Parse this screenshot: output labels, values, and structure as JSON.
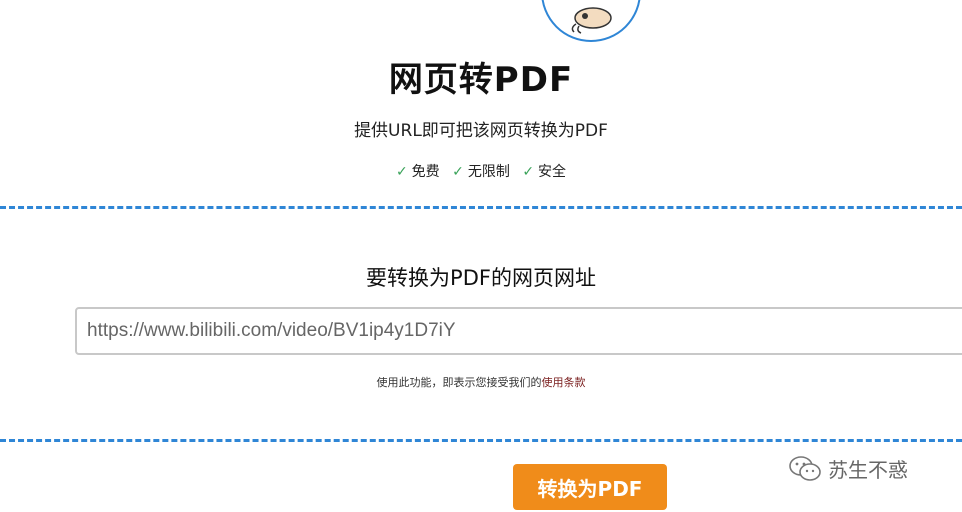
{
  "header": {
    "logo_icon": "mascot-logo-icon",
    "title": "网页转PDF",
    "subtitle": "提供URL即可把该网页转换为PDF",
    "features": [
      {
        "check": "✓",
        "label": "免费"
      },
      {
        "check": "✓",
        "label": "无限制"
      },
      {
        "check": "✓",
        "label": "安全"
      }
    ]
  },
  "form": {
    "label": "要转换为PDF的网页网址",
    "url_value": "https://www.bilibili.com/video/BV1ip4y1D7iY",
    "terms_prefix": "使用此功能，即表示您接受我们的",
    "terms_link": "使用条款"
  },
  "actions": {
    "convert_label": "转换为PDF"
  },
  "watermark": {
    "icon": "wechat-icon",
    "text": "苏生不惑"
  },
  "colors": {
    "accent_blue": "#2f86d6",
    "button_orange": "#f08c1a",
    "check_green": "#3aa35a"
  }
}
